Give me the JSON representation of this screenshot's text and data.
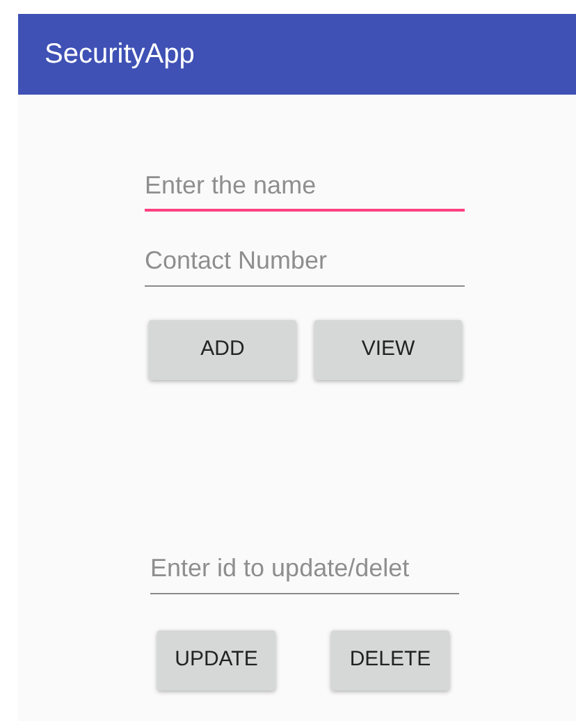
{
  "app_bar": {
    "title": "SecurityApp"
  },
  "fields": [
    {
      "placeholder": "Enter the name",
      "focused": true
    },
    {
      "placeholder": "Contact Number",
      "focused": false
    }
  ],
  "buttons": [
    "ADD",
    "VIEW"
  ],
  "id_field": {
    "placeholder": "Enter id to update/delet",
    "focused": false
  },
  "bottom_buttons": [
    "UPDATE",
    "DELETE"
  ]
}
